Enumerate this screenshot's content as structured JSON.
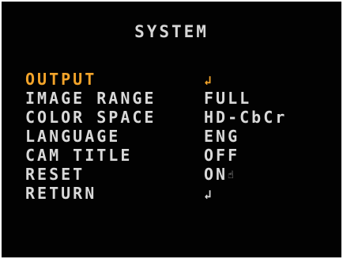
{
  "menu": {
    "title": "SYSTEM",
    "selected_index": 0,
    "items": [
      {
        "label": "OUTPUT",
        "value": "",
        "value_icon": "enter-icon",
        "value_icon_glyph": "↲"
      },
      {
        "label": "IMAGE RANGE",
        "value": "FULL"
      },
      {
        "label": "COLOR SPACE",
        "value": "HD-CbCr"
      },
      {
        "label": "LANGUAGE",
        "value": "ENG"
      },
      {
        "label": "CAM TITLE",
        "value": "OFF"
      },
      {
        "label": "RESET",
        "value": "ON",
        "value_icon": "hand-pointer-icon",
        "value_icon_glyph": "☝"
      },
      {
        "label": "RETURN",
        "value": "",
        "value_icon": "enter-icon",
        "value_icon_glyph": "↲"
      }
    ]
  },
  "colors": {
    "background": "#020202",
    "text": "#d9d9d9",
    "highlight": "#f3a42a"
  }
}
